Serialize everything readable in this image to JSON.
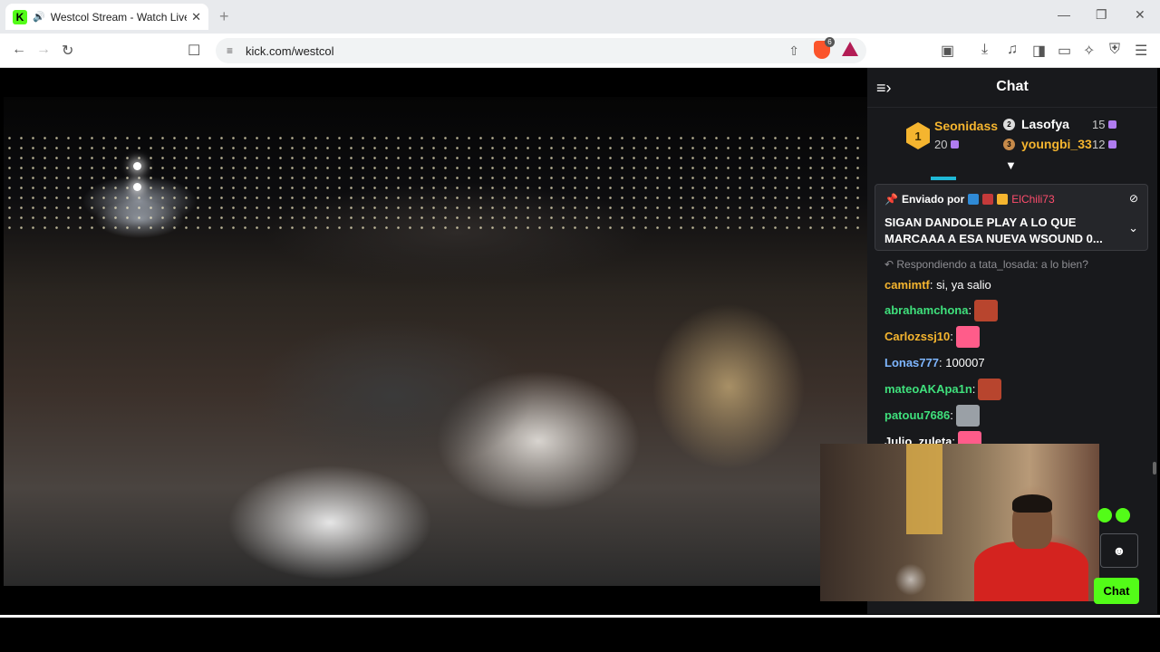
{
  "browser": {
    "tab": {
      "favicon": "K",
      "title": "Westcol Stream - Watch Live",
      "close": "✕"
    },
    "new_tab": "+",
    "window_controls": {
      "minimize": "—",
      "restore": "❐",
      "close": "✕"
    },
    "url": "kick.com/westcol",
    "shield_badge": "6",
    "colors": {
      "kick_green": "#53fc18",
      "brave_orange": "#fb542b"
    }
  },
  "icons": {
    "back": "arrow-left-icon",
    "forward": "arrow-right-icon",
    "reload": "reload-icon",
    "bookmark": "bookmark-icon",
    "site_info": "tune-icon",
    "share": "share-icon",
    "brave_shields": "brave-shield-icon",
    "rewards": "rewards-triangle-icon",
    "downloads": "download-icon",
    "music": "music-icon",
    "sidebar": "sidebar-icon",
    "wallet": "wallet-icon",
    "leo": "leo-icon",
    "vpn": "vpn-shield-icon",
    "menu": "hamburger-icon"
  },
  "chat": {
    "title": "Chat",
    "top_gifters": [
      {
        "rank": "1",
        "name": "Seonidass",
        "count": "20",
        "color": "#f5b52f"
      },
      {
        "rank": "2",
        "name": "Lasofya",
        "count": "15",
        "color": "#ffffff"
      },
      {
        "rank": "3",
        "name": "youngbi_33",
        "count": "12",
        "color": "#f5b52f"
      }
    ],
    "pinned": {
      "prefix": "Enviado por",
      "sender": "ElChili73",
      "text": "SIGAN DANDOLE PLAY A LO QUE MARCAAA A ESA NUEVA WSOUND 0..."
    },
    "reply_to": "Respondiendo a tata_losada: a lo bien?",
    "messages": [
      {
        "user": "camimtf",
        "text": ": si, ya salio",
        "color": "#f5b52f"
      },
      {
        "user": "abrahamchona",
        "text": ":",
        "color": "#3fe07c",
        "emote": "#b8452e"
      },
      {
        "user": "Carlozssj10",
        "text": ":",
        "color": "#f5b52f",
        "emote": "#ff5c8a"
      },
      {
        "user": "Lonas777",
        "text": ": 100007",
        "color": "#7eb6ff"
      },
      {
        "user": "mateoAKApa1n",
        "text": ":",
        "color": "#3fe07c",
        "emote": "#b8452e"
      },
      {
        "user": "patouu7686",
        "text": ":",
        "color": "#3fe07c",
        "emote": "#9aa0a6"
      },
      {
        "user": "Julio_zuleta",
        "text": ":",
        "color": "#ffffff",
        "emote": "#ff5c8a"
      }
    ],
    "emoji_button": "☻",
    "send_button": "Chat"
  }
}
